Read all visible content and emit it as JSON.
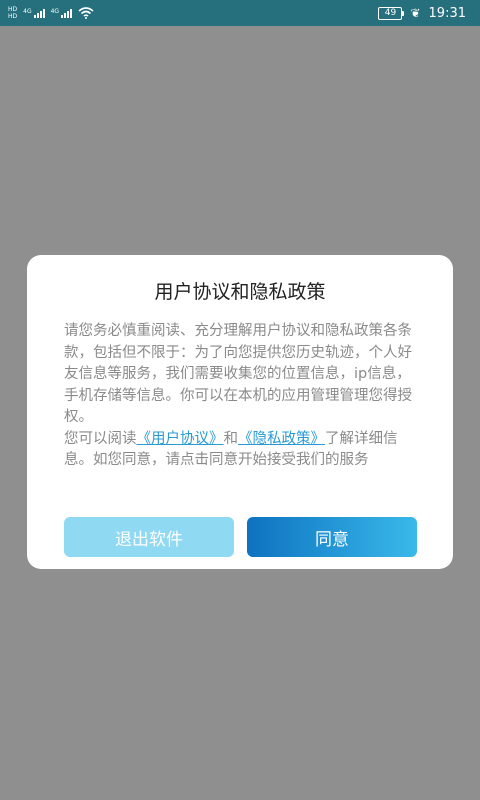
{
  "status_bar": {
    "hd1": "HD",
    "hd2": "HD",
    "net1": "4G",
    "net2": "4G",
    "battery": "49",
    "time": "19:31"
  },
  "dialog": {
    "title": "用户协议和隐私政策",
    "paragraph1": "请您务必慎重阅读、充分理解用户协议和隐私政策各条款，包括但不限于：为了向您提供您历史轨迹，个人好友信息等服务，我们需要收集您的位置信息，ip信息，手机存储等信息。你可以在本机的应用管理管理您得授权。",
    "p2_prefix": "您可以阅读",
    "user_agreement_link": "《用户协议》",
    "p2_and": "和",
    "privacy_policy_link": "《隐私政策》",
    "p2_suffix": "了解详细信息。如您同意，请点击同意开始接受我们的服务"
  },
  "buttons": {
    "exit_label": "退出软件",
    "agree_label": "同意"
  },
  "colors": {
    "status_bar": "#25707c",
    "overlay": "#8f8f8f",
    "link": "#2a9ad5",
    "exit_button": "#8fd9f3",
    "agree_gradient_start": "#0d72c0",
    "agree_gradient_end": "#3ab9ea"
  }
}
